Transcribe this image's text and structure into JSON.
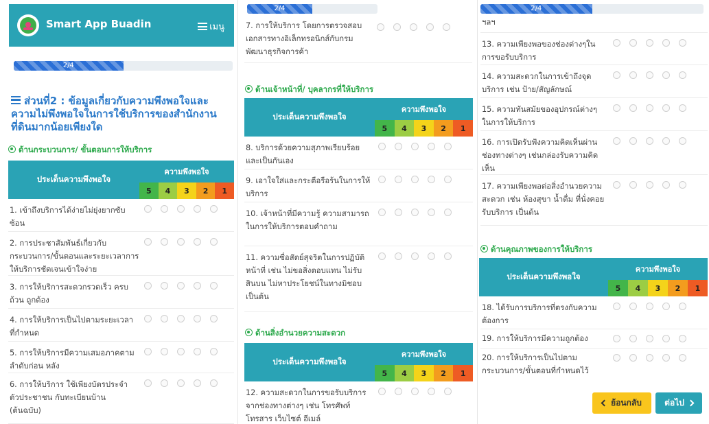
{
  "header": {
    "app_title": "Smart App Buadin",
    "menu_label": "เมนู"
  },
  "progress": {
    "label": "2/4",
    "fraction": 0.5
  },
  "section_title": "ส่วนที่2 : ข้อมูลเกี่ยวกับความพึงพอใจและความไม่พึงพอใจในการใช้บริการของสำนักงานที่ดินมากน้อยเพียงใด",
  "table_header": {
    "issue": "ประเด็นความพึงพอใจ",
    "satisfaction": "ความพึงพอใจ",
    "scores": [
      "5",
      "4",
      "3",
      "2",
      "1"
    ]
  },
  "categories": {
    "process": "ด้านกระบวนการ/ ขั้นตอนการให้บริการ",
    "staff": "ด้านเจ้าหน้าที่/ บุคลากรที่ให้บริการ",
    "facility": "ด้านสิ่งอำนวยความสะดวก",
    "quality": "ด้านคุณภาพของการให้บริการ"
  },
  "questions": {
    "q1": "1. เข้าถึงบริการได้ง่ายไม่ยุ่งยากซับซ้อน",
    "q2": "2. การประชาสัมพันธ์เกี่ยวกับกระบวนการ/ขั้นตอนและระยะเวลาการให้บริการชัดเจนเข้าใจง่าย",
    "q3": "3. การให้บริการสะดวกรวดเร็ว ครบถ้วน ถูกต้อง",
    "q4": "4. การให้บริการเป็นไปตามระยะเวลาที่กำหนด",
    "q5": "5. การให้บริการมีความเสมอภาคตามลำดับก่อน หลัง",
    "q6": "6. การให้บริการ ใช้เพียงบัตรประจำตัวประชาชน กับทะเบียนบ้าน (ต้นฉบับ)",
    "q7": "7. การให้บริการ โดยการตรวจสอบเอกสารทางอิเล็กทรอนิกส์กับกรมพัฒนาธุรกิจการค้า",
    "q8": "8. บริการด้วยความสุภาพเรียบร้อยและเป็นกันเอง",
    "q9": "9. เอาใจใส่และกระตือรือร้นในการให้บริการ",
    "q10": "10. เจ้าหน้าที่มีความรู้ ความสามารถในการให้บริการตอบคำถาม",
    "q11": "11. ความซื่อสัตย์สุจริตในการปฏิบัติหน้าที่ เช่น ไม่ขอสิ่งตอบแทน ไม่รับสินบน ไม่หาประโยชน์ในทางมิชอบ เป็นต้น",
    "q12": "12. ความสะดวกในการขอรับบริการจากช่องทางต่างๆ เช่น โทรศัพท์ โทรสาร เว็บไซต์ อีเมล์",
    "q12_tail": "ฯลฯ",
    "q13": "13. ความเพียงพอของช่องต่างๆในการขอรับบริการ",
    "q14": "14. ความสะดวกในการเข้าถึงจุดบริการ เช่น ป้าย/สัญลักษณ์",
    "q15": "15. ความทันสมัยของอุปกรณ์ต่างๆในการให้บริการ",
    "q16": "16. การเปิดรับฟังความคิดเห็นผ่านช่องทางต่างๆ เช่นกล่องรับความคิดเห็น",
    "q17": "17. ความเพียงพอต่อสิ่งอำนวยความสะดวก เช่น ห้องสุขา น้ำดื่ม ที่นั่งคอยรับบริการ เป็นต้น",
    "q18": "18. ได้รับการบริการที่ตรงกับความต้องการ",
    "q19": "19. การให้บริการมีความถูกต้อง",
    "q20": "20. การให้บริการเป็นไปตามกระบวนการ/ขั้นตอนที่กำหนดไว้"
  },
  "buttons": {
    "back": "ย้อนกลับ",
    "next": "ต่อไป"
  }
}
